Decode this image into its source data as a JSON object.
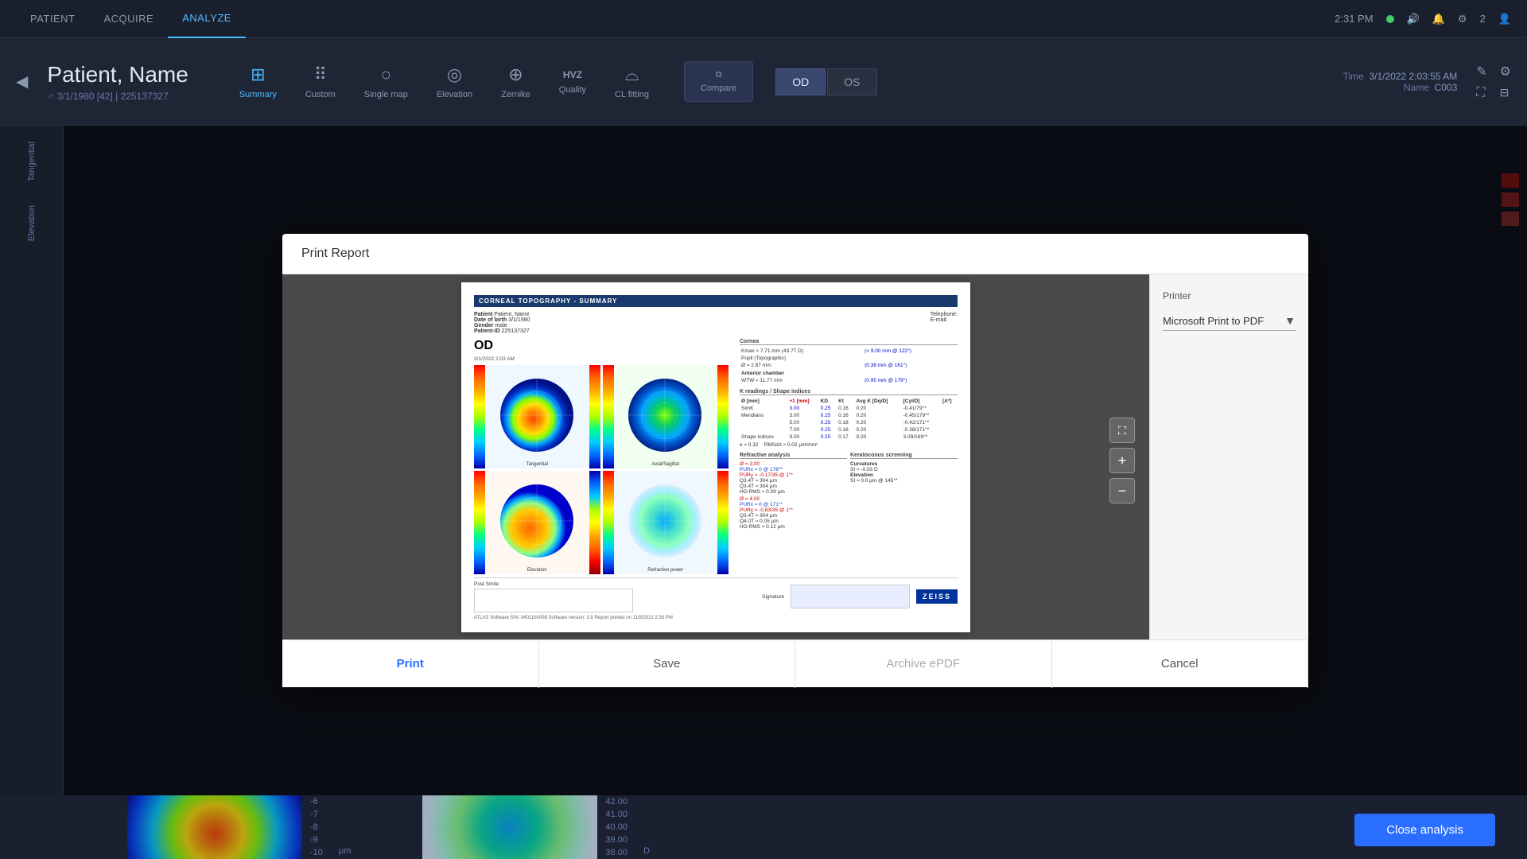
{
  "app": {
    "title": "ATLAS Software"
  },
  "topnav": {
    "items": [
      {
        "id": "patient",
        "label": "PATIENT"
      },
      {
        "id": "acquire",
        "label": "ACQUIRE"
      },
      {
        "id": "analyze",
        "label": "ANALYZE"
      }
    ],
    "active": "ANALYZE",
    "time": "2:31 PM",
    "status": "online"
  },
  "toolbar": {
    "back_icon": "◀",
    "patient_name": "Patient, Name",
    "patient_meta": "♂  3/1/1980 [42]  |  225137327",
    "icons": [
      {
        "id": "summary",
        "label": "Summary",
        "symbol": "⊞",
        "active": true
      },
      {
        "id": "custom",
        "label": "Custom",
        "symbol": "⠿",
        "active": false
      },
      {
        "id": "single_map",
        "label": "Single map",
        "symbol": "○",
        "active": false
      },
      {
        "id": "elevation",
        "label": "Elevation",
        "symbol": "◎",
        "active": false
      },
      {
        "id": "zernike",
        "label": "Zernike",
        "symbol": "⊕",
        "active": false
      },
      {
        "id": "quality",
        "label": "Quality",
        "symbol": "HVZ",
        "active": false
      },
      {
        "id": "cl_fitting",
        "label": "CL fitting",
        "symbol": "⌓",
        "active": false
      }
    ],
    "compare_label": "Compare",
    "od_label": "OD",
    "os_label": "OS",
    "time_label": "Time",
    "time_value": "3/1/2022 2:03:55 AM",
    "name_label": "Name",
    "name_value": "C003"
  },
  "sidebar": {
    "items": [
      {
        "id": "tangential",
        "label": "Tangential"
      },
      {
        "id": "elevation",
        "label": "Elevation"
      }
    ]
  },
  "print_modal": {
    "title": "Print Report",
    "report_title": "CORNEAL TOPOGRAPHY - SUMMARY",
    "patient_label": "Patient",
    "patient_value": "Patient, Name",
    "dob_label": "Date of birth",
    "dob_value": "3/1/1980",
    "gender_label": "Gender",
    "gender_value": "male",
    "id_label": "Patient-ID",
    "id_value": "225137327",
    "telephone_label": "Telephone:",
    "email_label": "E-mail:",
    "od_label": "OD",
    "scan_time": "3/1/2022 2:03 AM",
    "map_labels": [
      "Tangential",
      "Axial/Sagittal",
      "Elevation",
      "Refractive power"
    ],
    "footer_text": "ATLAS Software    S/N: 9401100008    Software version: 3.8    Report printed on 11/9/2022 2:30 PM",
    "post_smile_label": "Post Smile",
    "signature_label": "Signature",
    "printer_section": {
      "label": "Printer",
      "value": "Microsoft Print to PDF",
      "dropdown_arrow": "▼"
    },
    "buttons": {
      "print": "Print",
      "save": "Save",
      "archive_epdf": "Archive ePDF",
      "cancel": "Cancel"
    }
  },
  "bottom_bar": {
    "scale_numbers": [
      "-6",
      "-7",
      "-8",
      "-9",
      "-10"
    ],
    "unit": "μm",
    "scale_numbers_right": [
      "42.00",
      "41.00",
      "40.00",
      "39.00",
      "38.00"
    ],
    "unit_right": "D",
    "close_analysis_label": "Close analysis"
  },
  "colors": {
    "accent_blue": "#2a6eff",
    "nav_active": "#4db8ff",
    "background_dark": "#1a1f2e",
    "modal_bg": "#ffffff"
  }
}
